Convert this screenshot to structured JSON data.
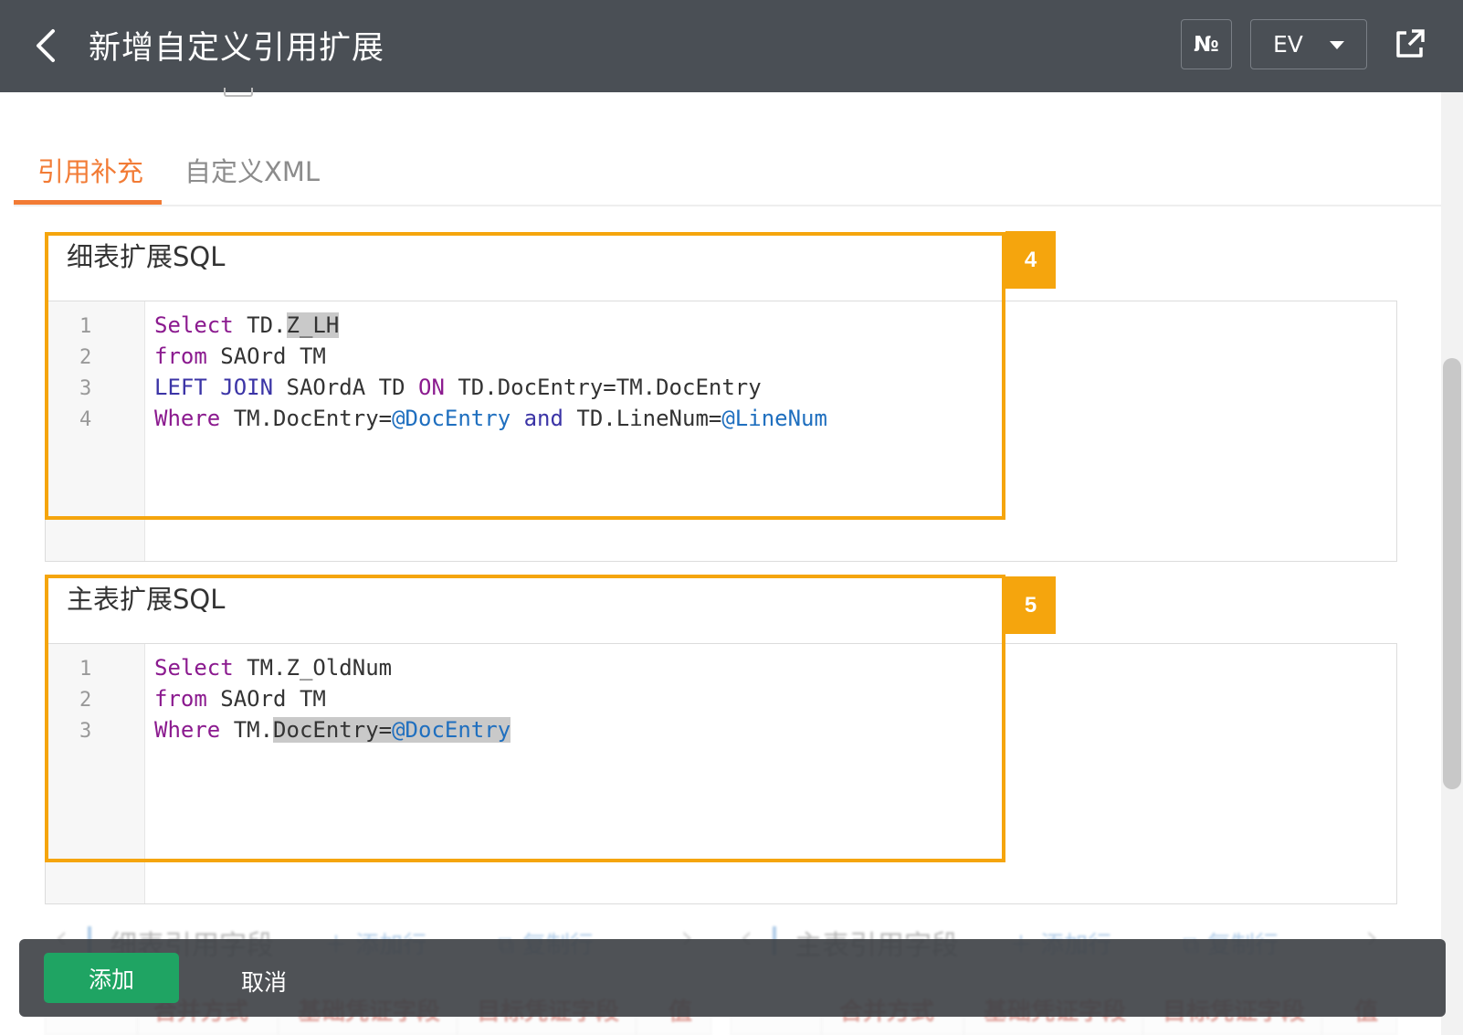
{
  "header": {
    "title": "新增自定义引用扩展",
    "no_label": "№",
    "ev_label": "EV"
  },
  "colors": {
    "header_bg": "#4a4f55",
    "accent_orange": "#f27b35",
    "callout": "#f5a50d",
    "add_green": "#1fa463",
    "sql_keyword": "#8b1a8f",
    "sql_join": "#3b34a6",
    "sql_variable": "#1f6fbf"
  },
  "tabs": [
    {
      "label": "引用补充",
      "active": true
    },
    {
      "label": "自定义XML",
      "active": false
    }
  ],
  "detail_sql": {
    "title": "细表扩展SQL",
    "badge": "4",
    "line_numbers": [
      "1",
      "2",
      "3",
      "4"
    ],
    "lines": [
      [
        {
          "t": "Select",
          "c": "kw1"
        },
        {
          "t": " TD.",
          "c": ""
        },
        {
          "t": "Z_LH",
          "c": "hl"
        }
      ],
      [
        {
          "t": "from",
          "c": "kw1"
        },
        {
          "t": " SAOrd TM",
          "c": ""
        }
      ],
      [
        {
          "t": "LEFT JOIN",
          "c": "kw2"
        },
        {
          "t": " SAOrdA TD ",
          "c": ""
        },
        {
          "t": "ON",
          "c": "kw1"
        },
        {
          "t": " TD.DocEntry=TM.DocEntry",
          "c": ""
        }
      ],
      [
        {
          "t": "Where",
          "c": "kw1"
        },
        {
          "t": " TM.DocEntry=",
          "c": ""
        },
        {
          "t": "@DocEntry",
          "c": "var"
        },
        {
          "t": " ",
          "c": ""
        },
        {
          "t": "and",
          "c": "kw2"
        },
        {
          "t": " TD.LineNum=",
          "c": ""
        },
        {
          "t": "@LineNum",
          "c": "var"
        }
      ]
    ]
  },
  "main_sql": {
    "title": "主表扩展SQL",
    "badge": "5",
    "line_numbers": [
      "1",
      "2",
      "3"
    ],
    "lines": [
      [
        {
          "t": "Select",
          "c": "kw1"
        },
        {
          "t": " TM.Z_OldNum",
          "c": ""
        }
      ],
      [
        {
          "t": "from",
          "c": "kw1"
        },
        {
          "t": " SAOrd TM",
          "c": ""
        }
      ],
      [
        {
          "t": "Where",
          "c": "kw1"
        },
        {
          "t": " TM.",
          "c": ""
        },
        {
          "t": "DocEntry",
          "c": "hl"
        },
        {
          "t": "=",
          "c": "hl"
        },
        {
          "t": "@DocEntry",
          "c": "var hl"
        }
      ]
    ]
  },
  "detail_fields": {
    "title": "细表引用字段",
    "add_row": "添加行",
    "copy_row": "复制行",
    "columns": [
      "合并方式",
      "基础凭证字段",
      "目标凭证字段",
      "值"
    ]
  },
  "main_fields": {
    "title": "主表引用字段",
    "add_row": "添加行",
    "copy_row": "复制行",
    "columns": [
      "合并方式",
      "基础凭证字段",
      "目标凭证字段",
      "值"
    ]
  },
  "actions": {
    "add": "添加",
    "cancel": "取消"
  }
}
